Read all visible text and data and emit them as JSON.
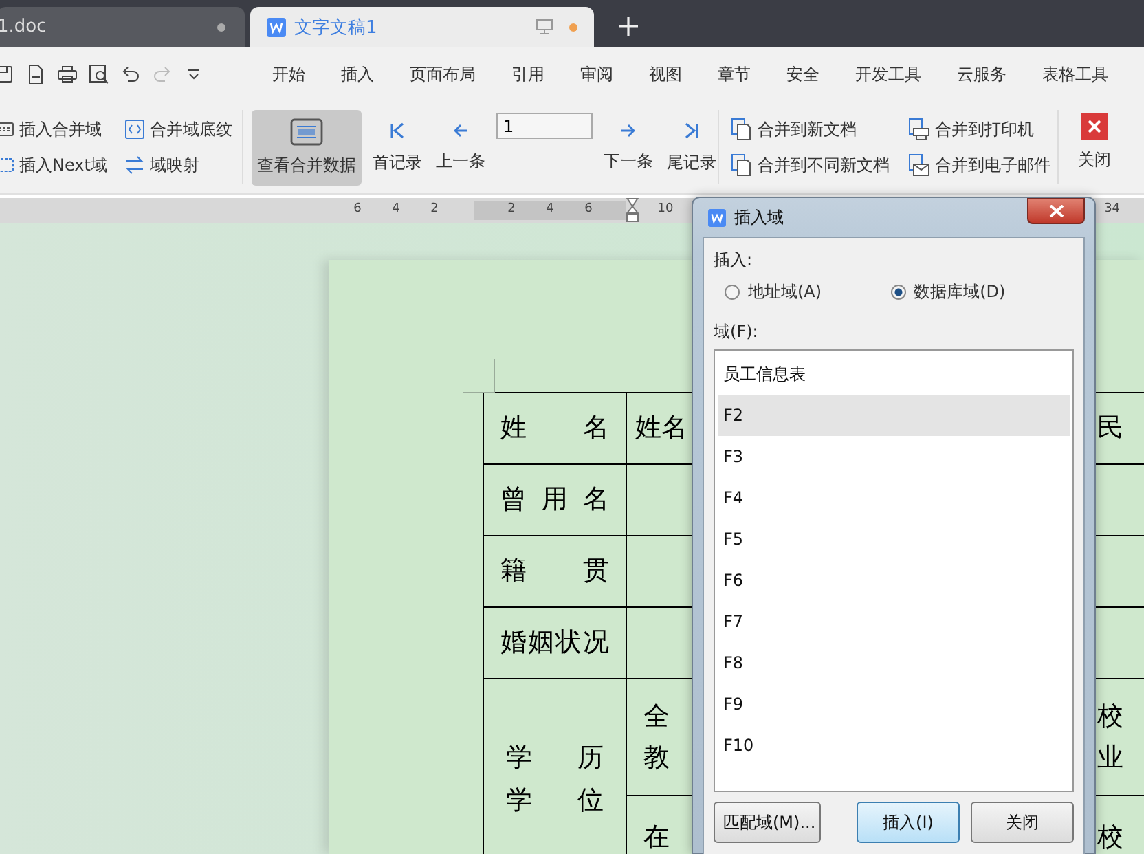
{
  "tabs": [
    {
      "title": "1.doc",
      "selected": false
    },
    {
      "title": "文字文稿1",
      "selected": true
    }
  ],
  "quick_access": [
    {
      "kind": "save",
      "disabled": false
    },
    {
      "kind": "pdf",
      "disabled": false
    },
    {
      "kind": "print",
      "disabled": false
    },
    {
      "kind": "preview",
      "disabled": false
    },
    {
      "kind": "undo",
      "disabled": false
    },
    {
      "kind": "redo",
      "disabled": true
    },
    {
      "kind": "more",
      "disabled": false
    }
  ],
  "menu": [
    "开始",
    "插入",
    "页面布局",
    "引用",
    "审阅",
    "视图",
    "章节",
    "安全",
    "开发工具",
    "云服务",
    "表格工具"
  ],
  "ribbon": {
    "field_tools": [
      {
        "label": "插入合并域",
        "kind": "fields"
      },
      {
        "label": "插入Next域",
        "kind": "next"
      },
      {
        "label": "合并域底纹",
        "kind": "shading"
      },
      {
        "label": "域映射",
        "kind": "map"
      }
    ],
    "view_button": {
      "label": "查看合并数据",
      "selected": true
    },
    "first": "首记录",
    "prev": "上一条",
    "record": "1",
    "next": "下一条",
    "last": "尾记录",
    "merge": [
      {
        "label": "合并到新文档",
        "kind": "document"
      },
      {
        "label": "合并到不同新文档",
        "kind": "document"
      },
      {
        "label": "合并到打印机",
        "kind": "printer"
      },
      {
        "label": "合并到电子邮件",
        "kind": "email"
      }
    ],
    "close": "关闭"
  },
  "ruler": [
    "6",
    "4",
    "2",
    "2",
    "4",
    "6",
    "10",
    "34"
  ],
  "table": {
    "rows": [
      {
        "label": [
          "姓 名"
        ],
        "cells": [
          {
            "value": [
              "姓名"
            ],
            "column_3": [
              "民"
            ]
          }
        ]
      },
      {
        "label": [
          "曾 用 名"
        ],
        "cells": [
          {}
        ]
      },
      {
        "label": [
          "籍 贯"
        ],
        "cells": [
          {}
        ]
      },
      {
        "label": [
          "婚姻状况"
        ],
        "cells": [
          {}
        ]
      },
      {
        "label": [
          "学 历",
          "学 位"
        ],
        "cells": [
          {
            "value": [
              "全",
              "教"
            ],
            "column_3": [
              "校",
              "业"
            ]
          },
          {
            "value": [
              "在"
            ],
            "column_3": [
              "校"
            ]
          }
        ]
      }
    ]
  },
  "dialog": {
    "title": "插入域",
    "insert_label": "插入:",
    "options": [
      {
        "label": "地址域(A)",
        "selected": false
      },
      {
        "label": "数据库域(D)",
        "selected": true
      }
    ],
    "fields_label": "域(F):",
    "fields": [
      {
        "label": "员工信息表",
        "selected": false
      },
      {
        "label": "F2",
        "selected": true
      },
      {
        "label": "F3",
        "selected": false
      },
      {
        "label": "F4",
        "selected": false
      },
      {
        "label": "F5",
        "selected": false
      },
      {
        "label": "F6",
        "selected": false
      },
      {
        "label": "F7",
        "selected": false
      },
      {
        "label": "F8",
        "selected": false
      },
      {
        "label": "F9",
        "selected": false
      },
      {
        "label": "F10",
        "selected": false
      }
    ],
    "buttons": [
      {
        "label": "匹配域(M)...",
        "default": false
      },
      {
        "label": "插入(I)",
        "default": true
      },
      {
        "label": "关闭",
        "default": false
      }
    ]
  }
}
